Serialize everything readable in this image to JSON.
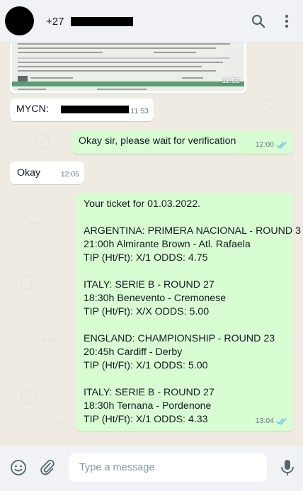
{
  "header": {
    "contact_prefix": "+27",
    "icons": [
      "search-icon",
      "menu-icon"
    ]
  },
  "messages": {
    "image_time": "11:52",
    "mycn_label": "MYCN:",
    "mycn_time": "11:53",
    "verification_text": "Okay sir, please wait for verification",
    "verification_time": "12:00",
    "okay_text": "Okay",
    "okay_time": "12:05",
    "ticket_lines": [
      "Your ticket for 01.03.2022.",
      "",
      "ARGENTINA: PRIMERA NACIONAL - ROUND 3",
      "21:00h Almirante Brown - Atl. Rafaela",
      "TIP (Ht/Ft): X/1  ODDS: 4.75",
      "",
      "ITALY: SERIE B - ROUND 27",
      "18:30h Benevento - Cremonese",
      "TIP (Ht/Ft): X/X  ODDS: 5.00",
      "",
      "ENGLAND: CHAMPIONSHIP - ROUND 23",
      "20:45h Cardiff - Derby",
      "TIP (Ht/Ft): X/1  ODDS: 5.00",
      "",
      "ITALY: SERIE B - ROUND 27",
      "18:30h Ternana - Pordenone",
      "TIP (Ht/Ft): X/1  ODDS: 4.33"
    ],
    "ticket_time": "13:04"
  },
  "composer": {
    "placeholder": "Type a message"
  },
  "colors": {
    "outgoing_bubble": "#d9fdd3",
    "incoming_bubble": "#ffffff",
    "read_ticks": "#53bdeb",
    "chat_background": "#efeae2"
  }
}
